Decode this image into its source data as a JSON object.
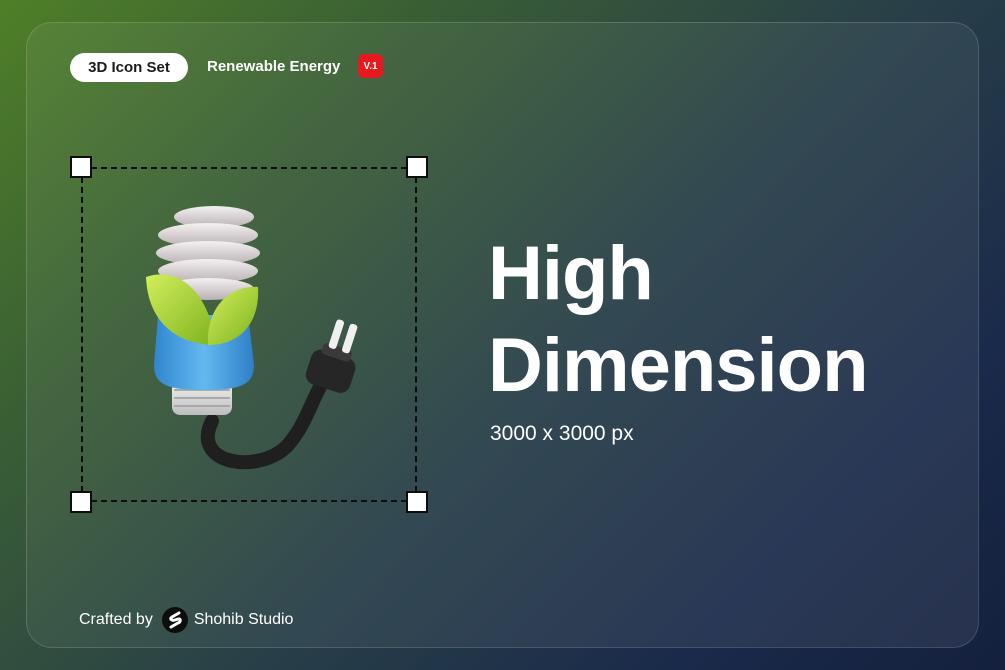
{
  "header": {
    "pill_label": "3D Icon Set",
    "subtitle": "Renewable Energy",
    "version_badge": "V.1"
  },
  "main": {
    "headline_line1": "High",
    "headline_line2": "Dimension",
    "dimension_text": "3000 x 3000 px",
    "illustration_icon": "eco-bulb-plug-icon"
  },
  "footer": {
    "crafted_by_label": "Crafted by",
    "studio_name": "Shohib Studio",
    "studio_logo_icon": "shohib-logo-icon"
  },
  "colors": {
    "accent_red": "#e8191e",
    "leaf_green": "#9acb2a",
    "bulb_blue": "#4aa8e6"
  }
}
